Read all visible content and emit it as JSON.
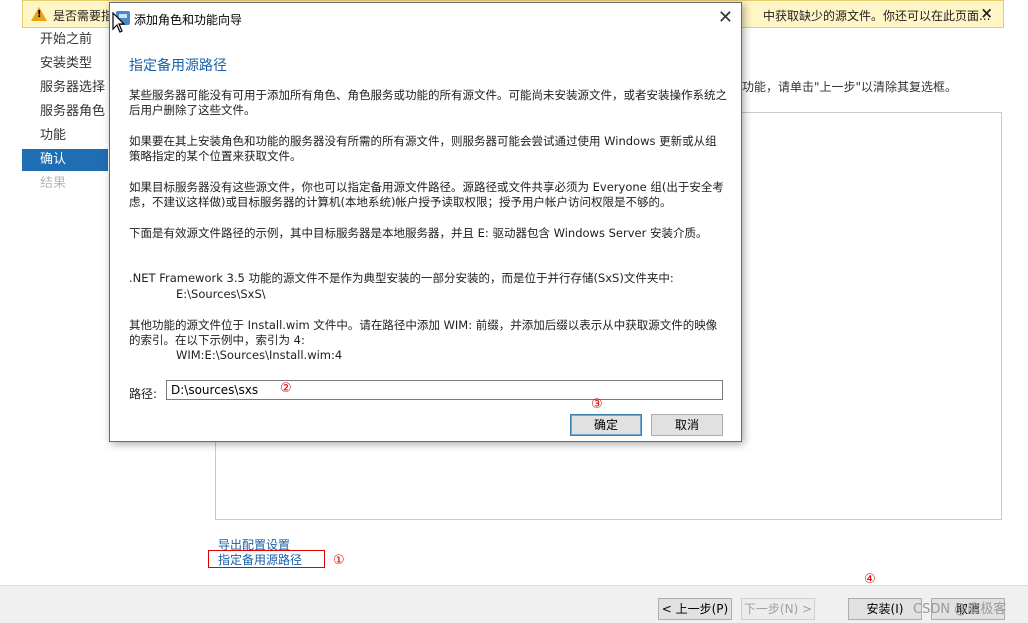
{
  "warning": {
    "text": "是否需要指",
    "text_tail": "中获取缺少的源文件。你还可以在此页面...",
    "close": "×"
  },
  "nav": {
    "items": [
      {
        "label": "开始之前",
        "state": "normal"
      },
      {
        "label": "安装类型",
        "state": "normal"
      },
      {
        "label": "服务器选择",
        "state": "normal"
      },
      {
        "label": "服务器角色",
        "state": "normal"
      },
      {
        "label": "功能",
        "state": "normal"
      },
      {
        "label": "确认",
        "state": "active"
      },
      {
        "label": "结果",
        "state": "disabled"
      }
    ]
  },
  "background": {
    "desc": "功能，请单击\"上一步\"以清除其复选框。",
    "export_link": "导出配置设置",
    "alt_source_link": "指定备用源路径",
    "marker1": "①",
    "marker4": "④"
  },
  "buttons": {
    "prev": "< 上一步(P)",
    "next": "下一步(N) >",
    "install": "安装(I)",
    "cancel": "取消"
  },
  "watermark": "CSDN @魔极客",
  "dialog": {
    "title": "添加角色和功能向导",
    "close": "✕",
    "heading": "指定备用源路径",
    "p1": "某些服务器可能没有可用于添加所有角色、角色服务或功能的所有源文件。可能尚未安装源文件，或者安装操作系统之后用户删除了这些文件。",
    "p2": "如果要在其上安装角色和功能的服务器没有所需的所有源文件，则服务器可能会尝试通过使用 Windows 更新或从组策略指定的某个位置来获取文件。",
    "p3": "如果目标服务器没有这些源文件，你也可以指定备用源文件路径。源路径或文件共享必须为 Everyone 组(出于安全考虑，不建议这样做)或目标服务器的计算机(本地系统)帐户授予读取权限；授予用户帐户访问权限是不够的。",
    "p4": "下面是有效源文件路径的示例，其中目标服务器是本地服务器，并且 E: 驱动器包含 Windows Server 安装介质。",
    "p5": ".NET Framework 3.5 功能的源文件不是作为典型安装的一部分安装的，而是位于并行存储(SxS)文件夹中:",
    "p5_path": "E:\\Sources\\SxS\\",
    "p6": "其他功能的源文件位于 Install.wim 文件中。请在路径中添加 WIM: 前缀，并添加后缀以表示从中获取源文件的映像的索引。在以下示例中，索引为 4:",
    "p6_path": "WIM:E:\\Sources\\Install.wim:4",
    "path_label": "路径:",
    "path_value": "D:\\sources\\sxs",
    "ok": "确定",
    "cancel": "取消",
    "marker2": "②",
    "marker3": "③"
  },
  "colors": {
    "accent": "#1f6db3",
    "link": "#1a5fa8",
    "heading": "#1560a8",
    "warning_bg": "#fff5c6",
    "annotation_red": "#e00000"
  }
}
